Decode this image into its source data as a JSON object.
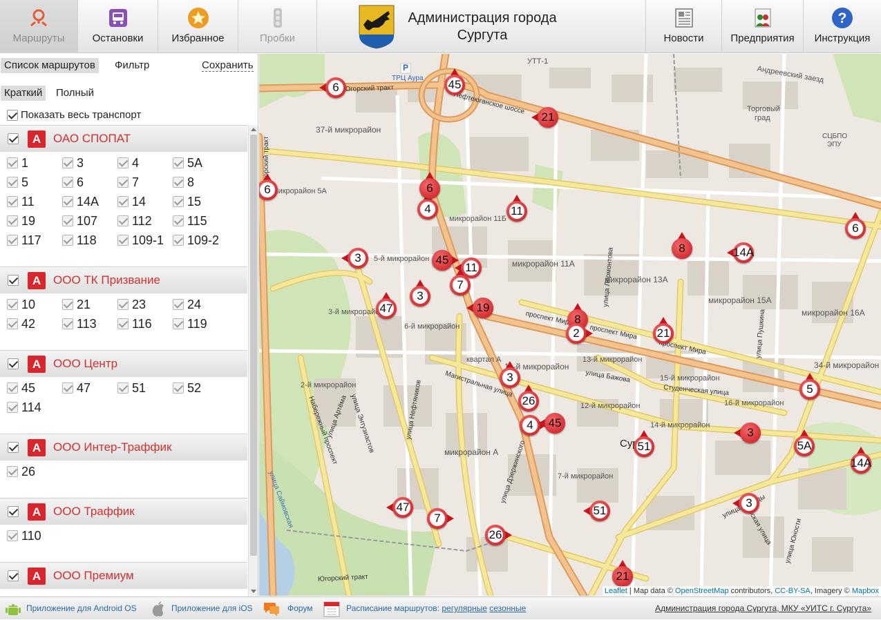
{
  "header": {
    "tabs": [
      {
        "label": "Маршруты",
        "icon": "route-pin-icon",
        "state": "active"
      },
      {
        "label": "Остановки",
        "icon": "bus-stop-icon",
        "state": "normal"
      },
      {
        "label": "Избранное",
        "icon": "star-icon",
        "state": "normal"
      },
      {
        "label": "Пробки",
        "icon": "traffic-light-icon",
        "state": "disabled"
      }
    ],
    "city_title_line1": "Администрация города",
    "city_title_line2": "Сургута",
    "right_tabs": [
      {
        "label": "Новости",
        "icon": "newspaper-icon"
      },
      {
        "label": "Предприятия",
        "icon": "people-icon"
      },
      {
        "label": "Инструкция",
        "icon": "help-icon"
      }
    ]
  },
  "sidebar": {
    "top_tabs": {
      "list": "Список маршрутов",
      "filter": "Фильтр",
      "save": "Сохранить"
    },
    "view_tabs": {
      "short": "Краткий",
      "full": "Полный"
    },
    "show_all_label": "Показать весь транспорт",
    "companies": [
      {
        "badge": "A",
        "name": "ОАО СПОПАТ",
        "routes": [
          "1",
          "3",
          "4",
          "5А",
          "5",
          "6",
          "7",
          "8",
          "11",
          "14А",
          "14",
          "15",
          "19",
          "107",
          "112",
          "115",
          "117",
          "118",
          "109-1",
          "109-2"
        ]
      },
      {
        "badge": "A",
        "name": "ООО ТК Призвание",
        "routes": [
          "10",
          "21",
          "23",
          "24",
          "42",
          "113",
          "116",
          "119"
        ]
      },
      {
        "badge": "A",
        "name": "ООО Центр",
        "routes": [
          "45",
          "47",
          "51",
          "52",
          "114"
        ]
      },
      {
        "badge": "A",
        "name": "ООО Интер-Траффик",
        "routes": [
          "26"
        ]
      },
      {
        "badge": "A",
        "name": "ООО Траффик",
        "routes": [
          "110"
        ]
      },
      {
        "badge": "A",
        "name": "ООО Премиум",
        "routes": []
      }
    ]
  },
  "map": {
    "labels": {
      "mkr37": "37-й микрорайон",
      "mkr5a": "микрорайон 5А",
      "mkr11b": "микрорайон 11Б",
      "mkr5": "5-й микрорайон",
      "mkr11a": "микрорайон 11А",
      "mkr13a": "микрорайон 13А",
      "mkr15a": "микрорайон 15А",
      "mkr16a": "микрорайон 16А",
      "mkr3": "3-й микрорайон",
      "mkr6": "6-й микрорайон",
      "kvartal_a": "квартал А",
      "mkr11": "11-й микрорайон",
      "mkr13": "13-й микрорайон",
      "mkr15": "15-й микрорайон",
      "mkr16": "16-й микрорайон",
      "mkr34": "34-й микрорайон",
      "mkr2": "2-й микрорайон",
      "mkr12": "12-й микрорайон",
      "mkr14": "14-й микрорайон",
      "mkr_a": "микрорайон А",
      "mkr7": "7-й микрорайон",
      "utt1": "УТТ-1",
      "andreevsky": "Андреевский заезд",
      "torg1": "Торговый",
      "torg2": "град",
      "sdpo1": "СЦБПО",
      "sdpo2": "ЭПУ",
      "trc": "ТРЦ Аура",
      "parking": "P",
      "ugorsky_trakt_top": "Югорский тракт",
      "ugorsky_trakt_vert": "Югорский тракт",
      "nefteyugansk": "Нефтеюганское шоссе",
      "lermontova": "улица Лермонтова",
      "pushkina": "улица Пушкина",
      "mira1": "проспект Мира",
      "mira2": "проспект Мира",
      "mira3": "проспект Мира",
      "bazhova": "улица Бажова",
      "studench": "Студенческая улица",
      "magistr": "Магистральная улица",
      "naberezh": "Набережный проспект",
      "artema": "улица Артёма",
      "entuziastov": "улица Энтузиастов",
      "neftyanikov": "улица Нефтяников",
      "dzerzhinskogo": "улица Дзержинского",
      "pobedy": "улица Победы",
      "sibirskaya": "Сибирская улица",
      "yunosti": "улица Юности",
      "ugorsky_bottom": "Югорский тракт",
      "surgut": "Сургут",
      "saymovskaya": "улица Саймовская"
    },
    "markers": [
      "6",
      "45",
      "21",
      "6",
      "4",
      "6",
      "11",
      "6",
      "8",
      "14А",
      "3",
      "45",
      "11",
      "7",
      "3",
      "47",
      "19",
      "8",
      "2",
      "21",
      "3",
      "26",
      "4",
      "45",
      "5",
      "3",
      "5А",
      "14А",
      "51",
      "3",
      "47",
      "7",
      "51",
      "26",
      "21"
    ],
    "attribution": {
      "leaflet": "Leaflet",
      "mid": " | Map data © ",
      "osm": "OpenStreetMap",
      "contrib": " contributors, ",
      "ccbysa": "CC-BY-SA",
      "imagery": ", Imagery © ",
      "mapbox": "Mapbox"
    }
  },
  "footer": {
    "android": "Приложение для Android OS",
    "ios": "Приложение для iOS",
    "forum": "Форум",
    "schedule_prefix": "Расписание маршрутов: ",
    "schedule_regular": "регулярные",
    "schedule_seasonal": "сезонные",
    "credits": "Администрация города Сургута, МКУ «УИТС г. Сургута»"
  },
  "colors": {
    "accent_red": "#d9262c",
    "link_blue": "#2a6aa8",
    "road_yellow": "#f5e89a",
    "road_orange": "#f2c38d"
  }
}
